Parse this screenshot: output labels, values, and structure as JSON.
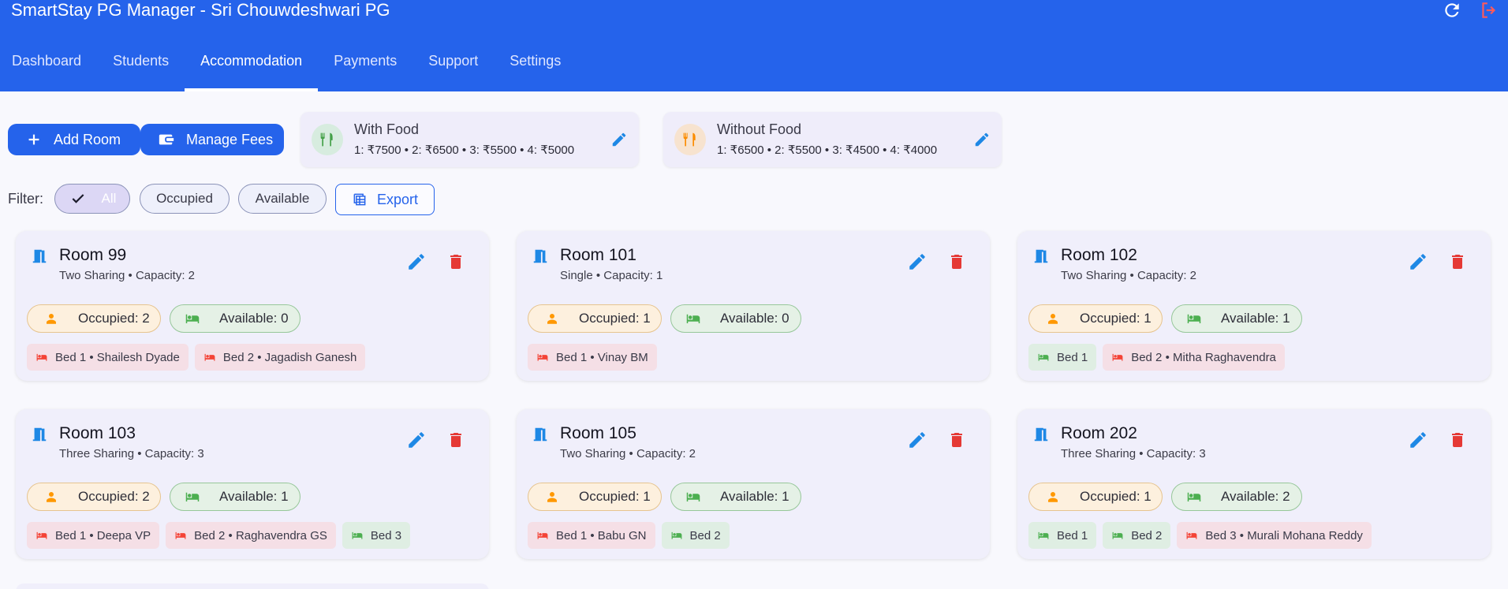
{
  "app": {
    "title": "SmartStay PG Manager - Sri Chouwdeshwari PG"
  },
  "colors": {
    "primary": "#2563eb",
    "occupied": "#f44336",
    "available": "#4caf50",
    "occupied_icon": "#ff9800"
  },
  "tabs": [
    {
      "label": "Dashboard"
    },
    {
      "label": "Students"
    },
    {
      "label": "Accommodation"
    },
    {
      "label": "Payments"
    },
    {
      "label": "Support"
    },
    {
      "label": "Settings"
    }
  ],
  "active_tab": "Accommodation",
  "toolbar": {
    "add_room": "Add Room",
    "manage_fees": "Manage Fees"
  },
  "food": {
    "with": {
      "title": "With Food",
      "prices": "1: ₹7500 • 2: ₹6500 • 3: ₹5500 • 4: ₹5000"
    },
    "without": {
      "title": "Without Food",
      "prices": "1: ₹6500 • 2: ₹5500 • 3: ₹4500 • 4: ₹4000"
    }
  },
  "filter": {
    "label": "Filter:",
    "all": "All",
    "occupied": "Occupied",
    "available": "Available",
    "export": "Export"
  },
  "rooms": [
    {
      "name": "Room 99",
      "meta": "Two Sharing • Capacity: 2",
      "occupied": "Occupied: 2",
      "available": "Available: 0",
      "beds": [
        {
          "label": "Bed 1 • Shailesh Dyade",
          "status": "occupied"
        },
        {
          "label": "Bed 2 • Jagadish Ganesh",
          "status": "occupied"
        }
      ]
    },
    {
      "name": "Room 101",
      "meta": "Single • Capacity: 1",
      "occupied": "Occupied: 1",
      "available": "Available: 0",
      "beds": [
        {
          "label": "Bed 1 • Vinay BM",
          "status": "occupied"
        }
      ]
    },
    {
      "name": "Room 102",
      "meta": "Two Sharing • Capacity: 2",
      "occupied": "Occupied: 1",
      "available": "Available: 1",
      "beds": [
        {
          "label": "Bed 1",
          "status": "available"
        },
        {
          "label": "Bed 2 • Mitha Raghavendra",
          "status": "occupied"
        }
      ]
    },
    {
      "name": "Room 103",
      "meta": "Three Sharing • Capacity: 3",
      "occupied": "Occupied: 2",
      "available": "Available: 1",
      "beds": [
        {
          "label": "Bed 1 • Deepa VP",
          "status": "occupied"
        },
        {
          "label": "Bed 2 • Raghavendra GS",
          "status": "occupied"
        },
        {
          "label": "Bed 3",
          "status": "available"
        }
      ]
    },
    {
      "name": "Room 105",
      "meta": "Two Sharing • Capacity: 2",
      "occupied": "Occupied: 1",
      "available": "Available: 1",
      "beds": [
        {
          "label": "Bed 1 • Babu GN",
          "status": "occupied"
        },
        {
          "label": "Bed 2",
          "status": "available"
        }
      ]
    },
    {
      "name": "Room 202",
      "meta": "Three Sharing • Capacity: 3",
      "occupied": "Occupied: 1",
      "available": "Available: 2",
      "beds": [
        {
          "label": "Bed 1",
          "status": "available"
        },
        {
          "label": "Bed 2",
          "status": "available"
        },
        {
          "label": "Bed 3 • Murali Mohana Reddy",
          "status": "occupied"
        }
      ]
    }
  ]
}
